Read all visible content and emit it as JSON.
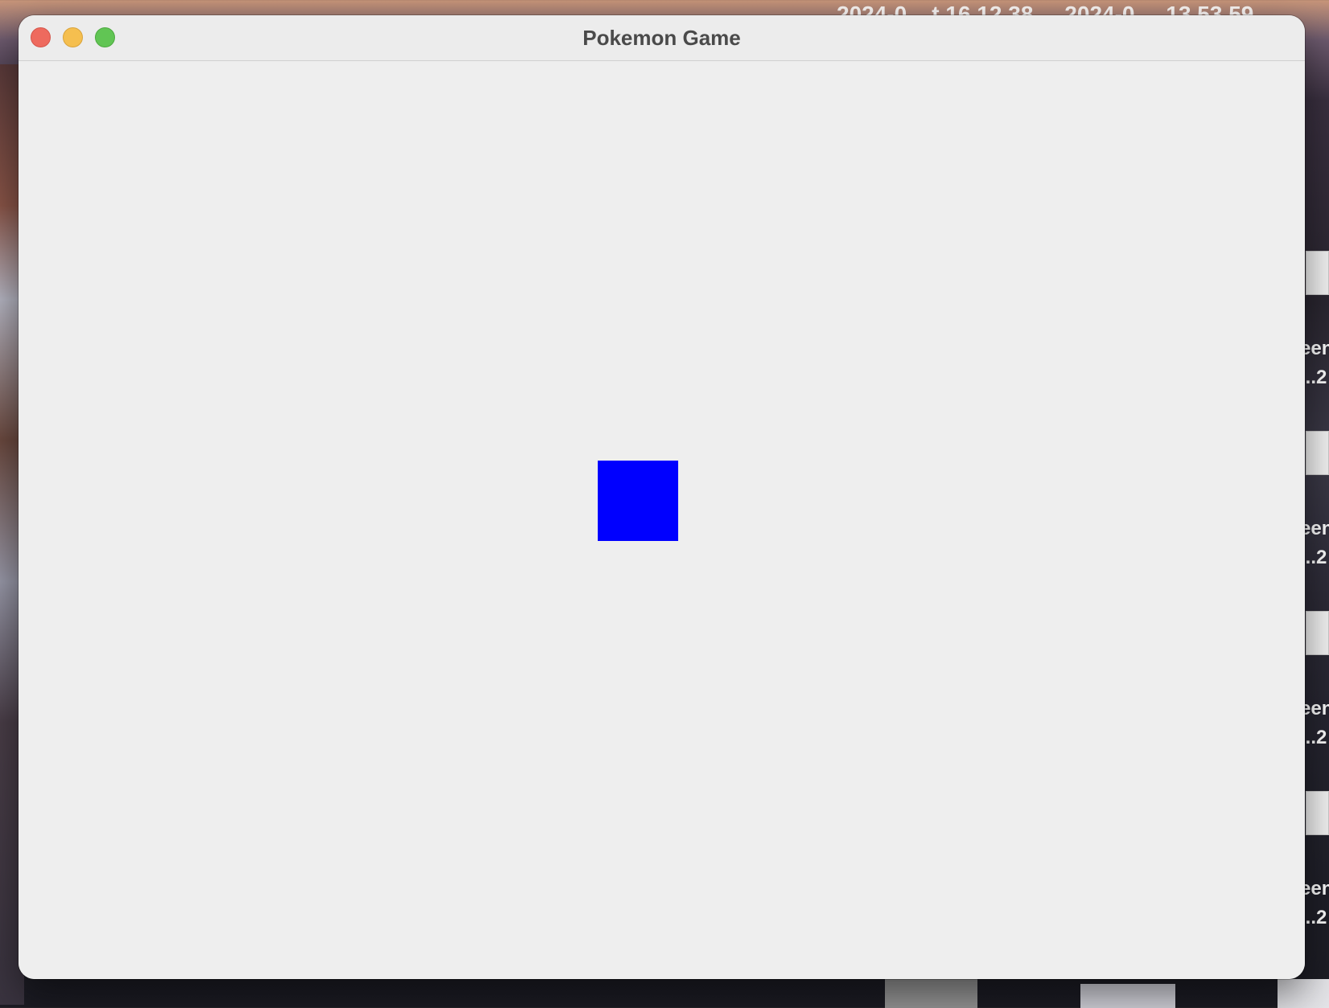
{
  "desktop": {
    "clock_text": "2024-0 ...t 16.12.38 ... 2024-0 ... 13.53.59",
    "side_labels": [
      "een\n...2",
      "een\n...2",
      "een\n...2",
      "een\n...2"
    ]
  },
  "window": {
    "title": "Pokemon Game",
    "controls": {
      "close": "close",
      "minimize": "minimize",
      "zoom": "zoom"
    }
  },
  "game": {
    "player_color": "#0000ff",
    "background_color": "#eeeeee"
  }
}
